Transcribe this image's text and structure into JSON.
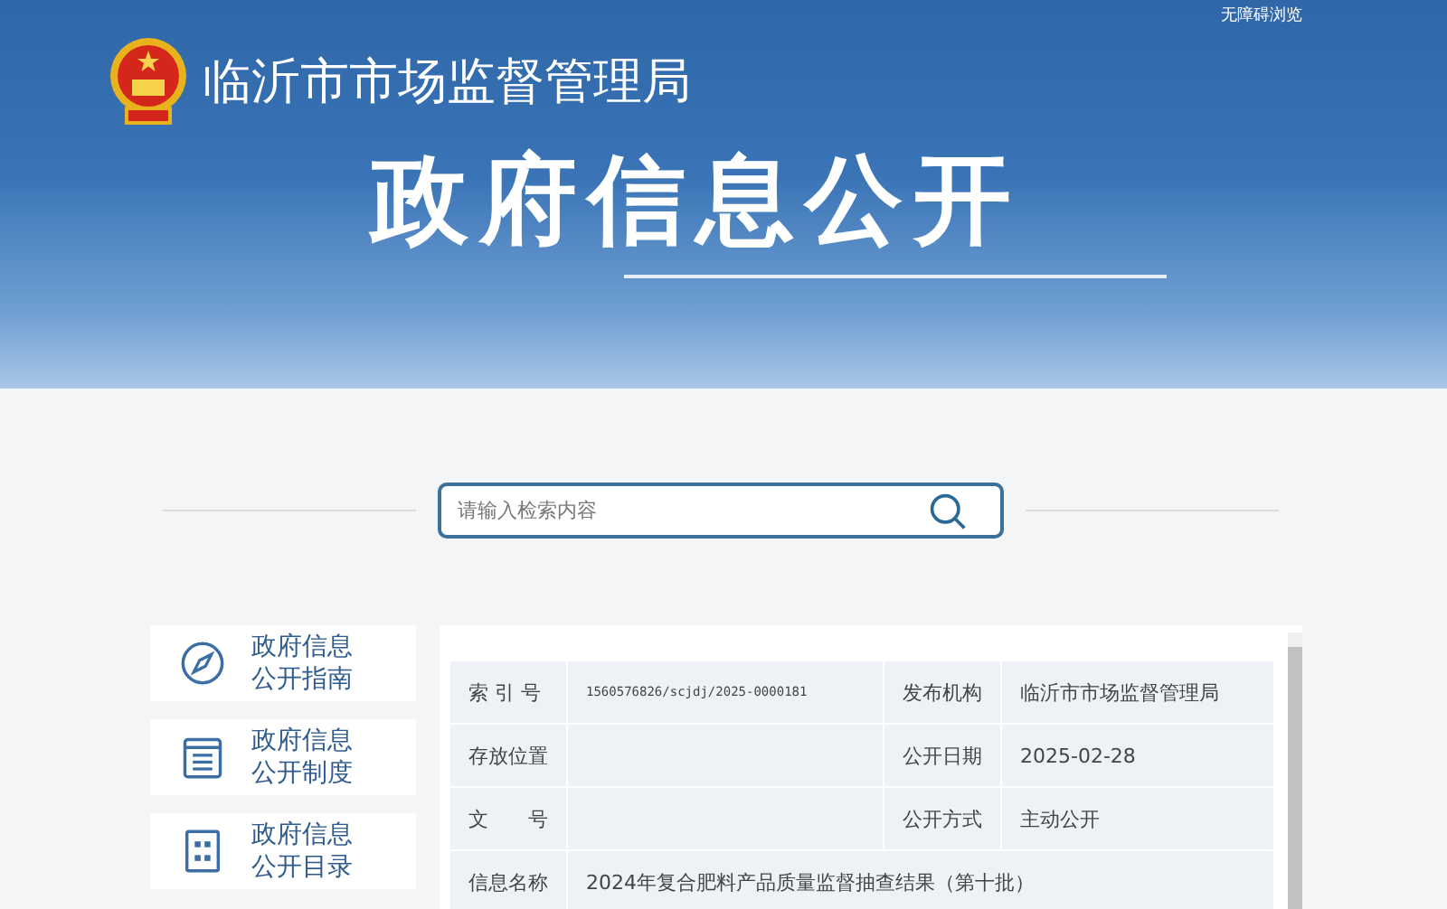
{
  "header": {
    "accessibility_link": "无障碍浏览",
    "site_title": "临沂市市场监督管理局",
    "banner_title": "政府信息公开"
  },
  "search": {
    "placeholder": "请输入检索内容"
  },
  "sidebar": {
    "items": [
      {
        "kind": "compass",
        "label": "政府信息公开指南"
      },
      {
        "kind": "list",
        "label": "政府信息公开制度"
      },
      {
        "kind": "grid",
        "label": "政府信息公开目录"
      }
    ]
  },
  "details": {
    "rows": [
      {
        "fields": [
          {
            "label": "索 引 号",
            "value": "1560576826/scjdj/2025-0000181",
            "kind": "code"
          },
          {
            "label": "发布机构",
            "value": "临沂市市场监督管理局"
          }
        ]
      },
      {
        "fields": [
          {
            "label": "存放位置"
          },
          {
            "label": "公开日期",
            "value": "2025-02-28"
          }
        ]
      },
      {
        "fields": [
          {
            "label": "文　　号"
          },
          {
            "label": "公开方式",
            "value": "主动公开"
          }
        ]
      },
      {
        "fields": [
          {
            "label": "信息名称",
            "value": "2024年复合肥料产品质量监督抽查结果（第十批）"
          }
        ]
      }
    ]
  }
}
